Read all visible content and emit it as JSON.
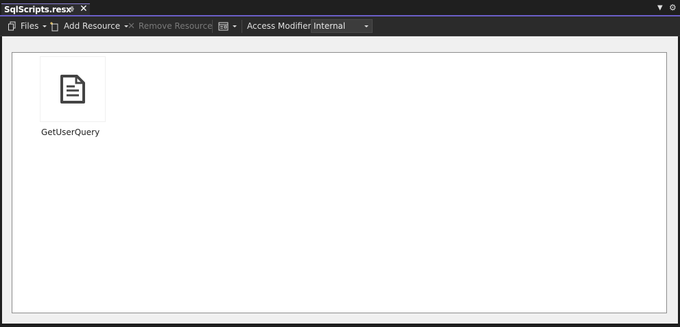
{
  "tab": {
    "title": "SqlScripts.resx",
    "pin_icon": "pin-icon",
    "close_icon": "close-icon"
  },
  "window_controls": {
    "dropdown_icon": "chevron-down-icon",
    "settings_icon": "gear-icon"
  },
  "toolbar": {
    "files_label": "Files",
    "add_resource_label": "Add Resource",
    "remove_resource_label": "Remove Resource",
    "view_icon": "view-icon",
    "access_modifier_label": "Access Modifier:",
    "access_modifier_value": "Internal"
  },
  "resources": [
    {
      "name": "GetUserQuery",
      "icon": "text-file-icon"
    }
  ],
  "colors": {
    "accent": "#6b5fc9",
    "toolbar_bg": "#2b2b2b",
    "editor_bg": "#f0f0f0"
  }
}
